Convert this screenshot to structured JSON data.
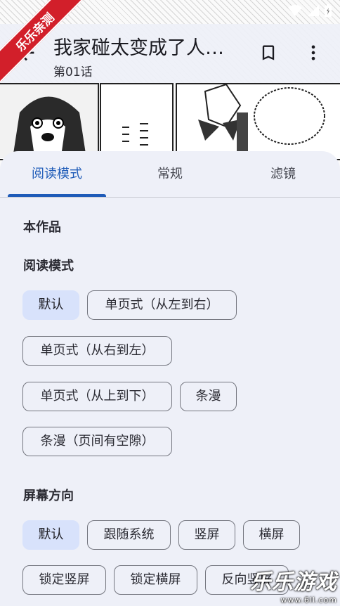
{
  "app": {
    "title": "我家碰太变成了人…",
    "chapter": "第01话",
    "ribbon": "乐乐亲测"
  },
  "icons": {
    "back": "arrow-back-icon",
    "bookmark": "bookmark-icon",
    "more": "more-vert-icon",
    "wifi": "wifi-icon",
    "signal": "signal-icon",
    "battery": "battery-icon"
  },
  "tabs": [
    {
      "label": "阅读模式",
      "active": true
    },
    {
      "label": "常规",
      "active": false
    },
    {
      "label": "滤镜",
      "active": false
    }
  ],
  "sections": {
    "work": "本作品",
    "reading_mode": "阅读模式",
    "orientation": "屏幕方向"
  },
  "reading_mode_options": [
    "默认",
    "单页式（从左到右）",
    "单页式（从右到左）",
    "单页式（从上到下）",
    "条漫",
    "条漫（页间有空隙）"
  ],
  "orientation_options": [
    "默认",
    "跟随系统",
    "竖屏",
    "横屏",
    "锁定竖屏",
    "锁定横屏",
    "反向竖屏"
  ],
  "selected": {
    "reading_mode": "默认",
    "orientation": "默认"
  },
  "watermark": {
    "main": "乐乐游戏",
    "url": "www.6ll.com"
  },
  "colors": {
    "accent": "#1e5bb8",
    "chip_selected": "#d8e2fb",
    "ribbon": "#d21f2a",
    "sheet": "#eef0f8"
  }
}
